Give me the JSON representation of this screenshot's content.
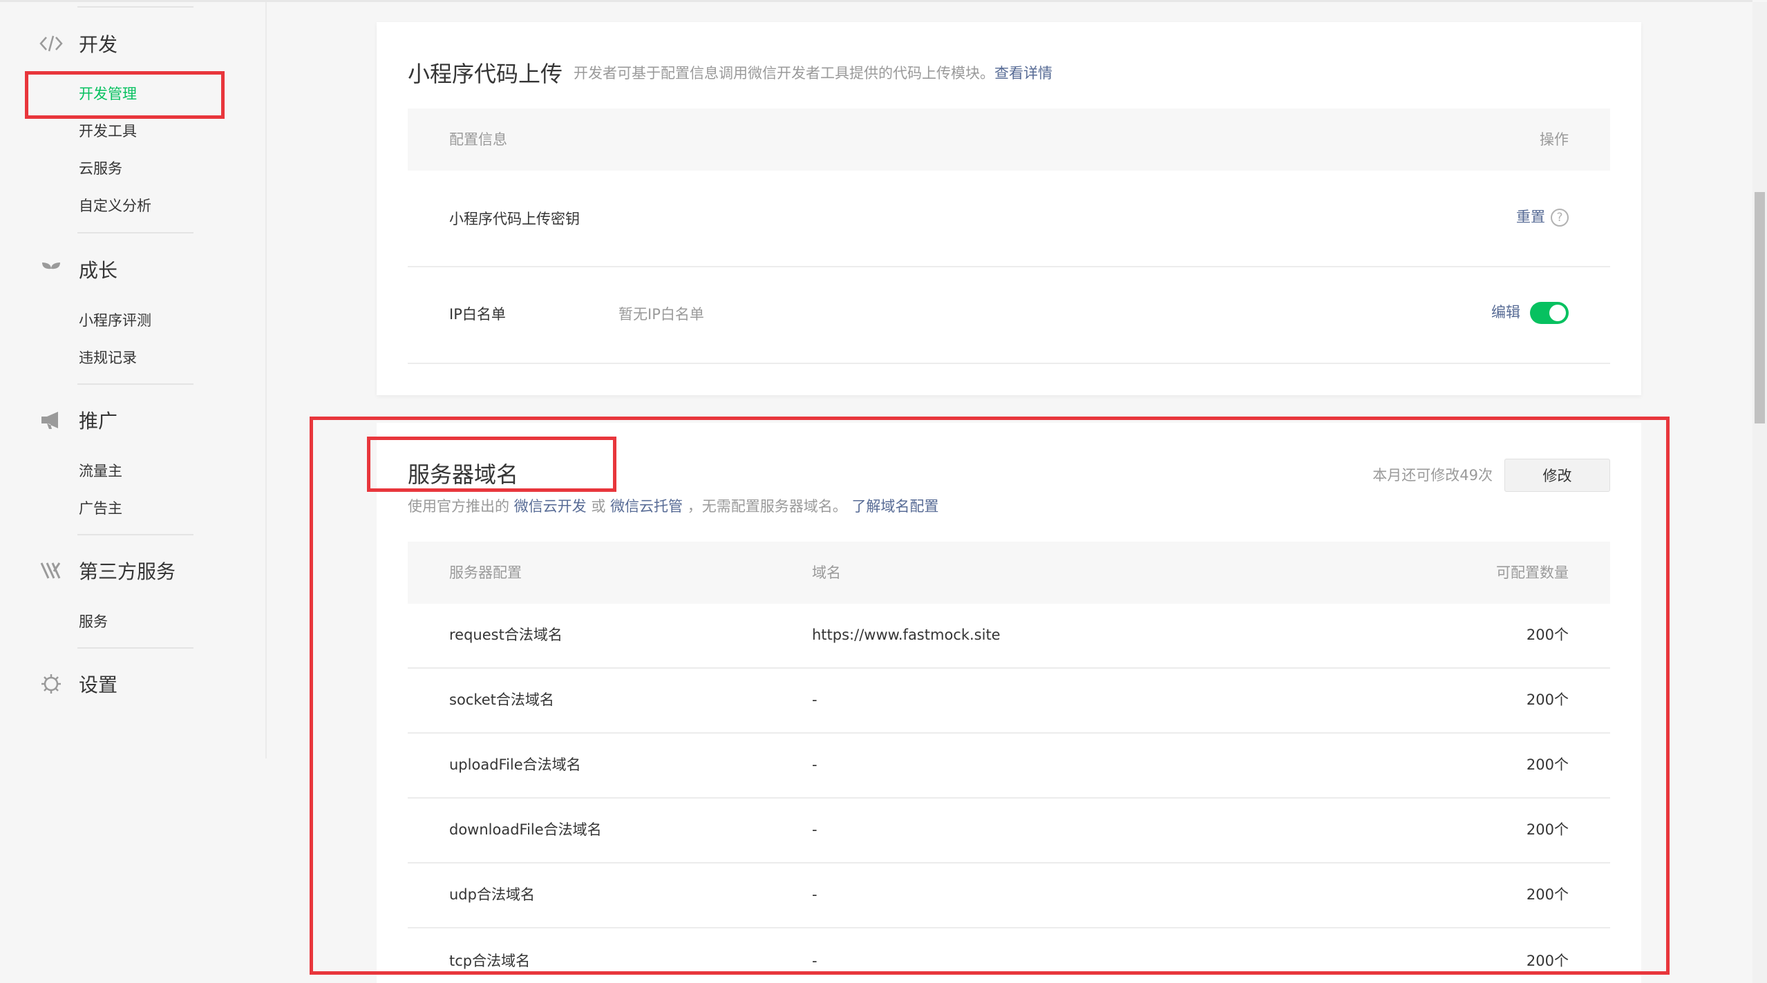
{
  "sidebar": {
    "sections": [
      {
        "title": "开发",
        "icon": "code-icon",
        "items": [
          "开发管理",
          "开发工具",
          "云服务",
          "自定义分析"
        ]
      },
      {
        "title": "成长",
        "icon": "sprout-icon",
        "items": [
          "小程序评测",
          "违规记录"
        ]
      },
      {
        "title": "推广",
        "icon": "megaphone-icon",
        "items": [
          "流量主",
          "广告主"
        ]
      },
      {
        "title": "第三方服务",
        "icon": "third-party-icon",
        "items": [
          "服务"
        ]
      },
      {
        "title": "设置",
        "icon": "gear-icon",
        "items": []
      }
    ],
    "active_item": "开发管理"
  },
  "upload_panel": {
    "title": "小程序代码上传",
    "desc": "开发者可基于配置信息调用微信开发者工具提供的代码上传模块。",
    "desc_link": "查看详情",
    "table_headers": [
      "配置信息",
      "操作"
    ],
    "rows": [
      {
        "label": "小程序代码上传密钥",
        "value": "",
        "action": "重置"
      },
      {
        "label": "IP白名单",
        "value": "暂无IP白名单",
        "action": "编辑"
      }
    ],
    "ip_whitelist_enabled": true
  },
  "domain_panel": {
    "title": "服务器域名",
    "desc_prefix": "使用官方推出的",
    "link1": "微信云开发",
    "or": "或",
    "link2": "微信云托管",
    "desc_suffix": "，无需配置服务器域名。",
    "link3": "了解域名配置",
    "remaining": "本月还可修改49次",
    "modify_button": "修改",
    "table_headers": [
      "服务器配置",
      "域名",
      "可配置数量"
    ],
    "rows": [
      {
        "name": "request合法域名",
        "domain": "https://www.fastmock.site",
        "count": "200个"
      },
      {
        "name": "socket合法域名",
        "domain": "-",
        "count": "200个"
      },
      {
        "name": "uploadFile合法域名",
        "domain": "-",
        "count": "200个"
      },
      {
        "name": "downloadFile合法域名",
        "domain": "-",
        "count": "200个"
      },
      {
        "name": "udp合法域名",
        "domain": "-",
        "count": "200个"
      },
      {
        "name": "tcp合法域名",
        "domain": "-",
        "count": "200个"
      }
    ]
  },
  "colors": {
    "accent": "#07c160",
    "link": "#576b95",
    "annotation": "#e8363c"
  }
}
